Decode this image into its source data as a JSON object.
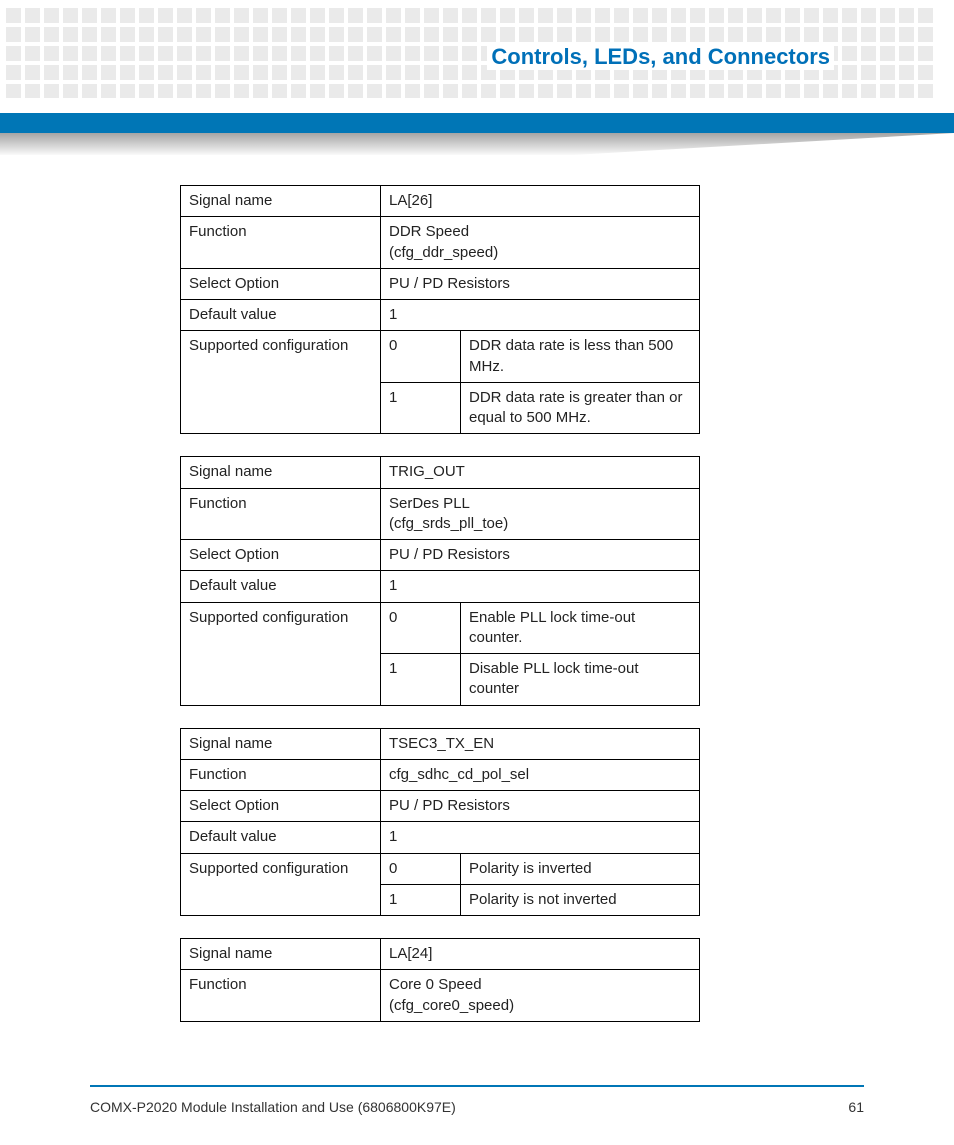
{
  "header": {
    "section_title": "Controls, LEDs, and Connectors"
  },
  "labels": {
    "signal_name": "Signal name",
    "function": "Function",
    "select_option": "Select Option",
    "default_value": "Default value",
    "supported_configuration": "Supported configuration"
  },
  "tables": [
    {
      "signal_name": "LA[26]",
      "function_line1": "DDR Speed",
      "function_line2": "(cfg_ddr_speed)",
      "select_option": "PU / PD Resistors",
      "default_value": "1",
      "configs": [
        {
          "code": "0",
          "desc": "DDR data rate is less than 500 MHz."
        },
        {
          "code": "1",
          "desc": "DDR data rate is greater than or equal to 500 MHz."
        }
      ]
    },
    {
      "signal_name": "TRIG_OUT",
      "function_line1": "SerDes PLL",
      "function_line2": "(cfg_srds_pll_toe)",
      "select_option": "PU / PD Resistors",
      "default_value": "1",
      "configs": [
        {
          "code": "0",
          "desc": "Enable PLL lock time-out counter."
        },
        {
          "code": "1",
          "desc": "Disable PLL lock time-out counter"
        }
      ]
    },
    {
      "signal_name": "TSEC3_TX_EN",
      "function_line1": "cfg_sdhc_cd_pol_sel",
      "function_line2": "",
      "select_option": "PU / PD Resistors",
      "default_value": "1",
      "configs": [
        {
          "code": "0",
          "desc": "Polarity is inverted"
        },
        {
          "code": "1",
          "desc": "Polarity is not inverted"
        }
      ]
    },
    {
      "signal_name": "LA[24]",
      "function_line1": "Core 0 Speed",
      "function_line2": "(cfg_core0_speed)",
      "select_option": "",
      "default_value": "",
      "configs": []
    }
  ],
  "footer": {
    "doc_title": "COMX-P2020 Module Installation and Use (6806800K97E)",
    "page_number": "61"
  }
}
